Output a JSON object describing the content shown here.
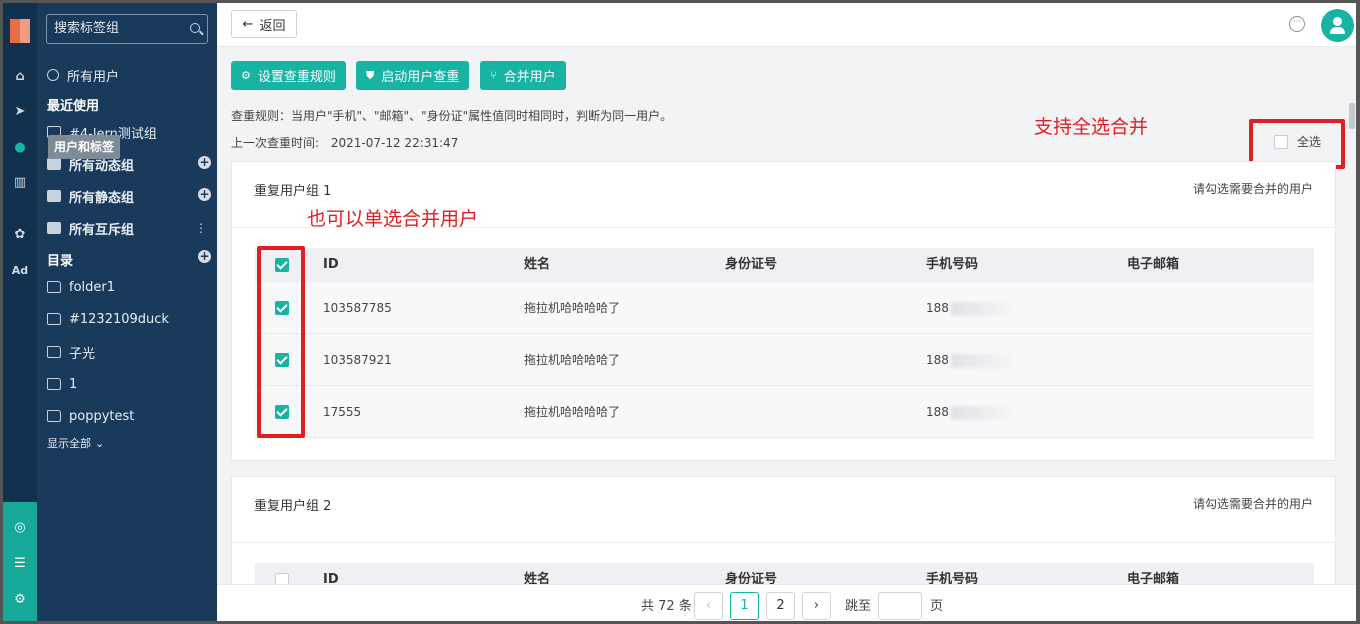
{
  "sidebar": {
    "search_placeholder": "搜索标签组",
    "all_users": "所有用户",
    "recent_heading": "最近使用",
    "recent_item": "#4-lern测试组",
    "tooltip": "用户和标签",
    "groups": [
      {
        "label": "所有动态组"
      },
      {
        "label": "所有静态组"
      },
      {
        "label": "所有互斥组"
      }
    ],
    "catalog_heading": "目录",
    "folders": [
      "folder1",
      "#1232109duck",
      "子光",
      "1",
      "poppytest"
    ],
    "show_all": "显示全部"
  },
  "topbar": {
    "back_label": "返回"
  },
  "toolbar": {
    "rule_button": "设置查重规则",
    "start_button": "启动用户查重",
    "merge_button": "合并用户"
  },
  "rule_text": "查重规则：当用户\"手机\"、\"邮箱\"、\"身份证\"属性值同时相同时，判断为同一用户。",
  "last_check": {
    "label": "上一次查重时间:",
    "value": "2021-07-12 22:31:47"
  },
  "select_all": {
    "label": "全选",
    "checked": false
  },
  "annotations": {
    "select_all_note": "支持全选合并",
    "single_select_note": "也可以单选合并用户"
  },
  "columns": [
    "ID",
    "姓名",
    "身份证号",
    "手机号码",
    "电子邮箱"
  ],
  "groups": [
    {
      "title": "重复用户组 1",
      "hint": "请勾选需要合并的用户",
      "header_checked": true,
      "rows": [
        {
          "checked": true,
          "id": "103587785",
          "name": "拖拉机哈哈哈哈了",
          "id_card": "",
          "phone": "188",
          "email": ""
        },
        {
          "checked": true,
          "id": "103587921",
          "name": "拖拉机哈哈哈哈了",
          "id_card": "",
          "phone": "188",
          "email": ""
        },
        {
          "checked": true,
          "id": "17555",
          "name": "拖拉机哈哈哈哈了",
          "id_card": "",
          "phone": "188",
          "email": ""
        }
      ]
    },
    {
      "title": "重复用户组 2",
      "hint": "请勾选需要合并的用户",
      "header_checked": false,
      "rows": []
    }
  ],
  "pagination": {
    "total": "共 72 条",
    "pages": [
      "1",
      "2"
    ],
    "current": "1",
    "jump_label": "跳至",
    "page_unit": "页"
  },
  "colors": {
    "accent": "#17b3a3",
    "sidebar_bg": "#1a3a5c",
    "rail_bg": "#12314f",
    "annotation": "#e02020"
  }
}
